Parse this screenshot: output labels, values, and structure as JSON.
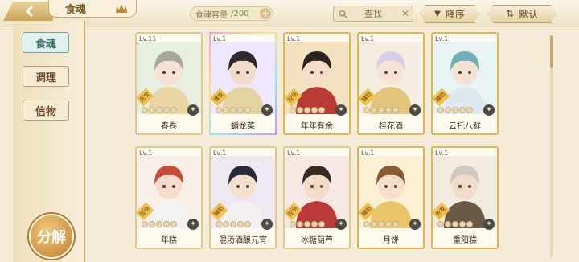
{
  "header": {
    "title": "食魂",
    "capacity_label": "食魂容量",
    "capacity_count": "/200",
    "search_placeholder": "查找",
    "sort_label": "降序",
    "default_label": "默认"
  },
  "sidebar": {
    "items": [
      {
        "label": "食魂",
        "active": true
      },
      {
        "label": "调理",
        "active": false
      },
      {
        "label": "信物",
        "active": false
      }
    ],
    "decompose_label": "分解"
  },
  "cards": [
    {
      "level": "Lv.11",
      "role": "先攻",
      "name": "春卷",
      "stars": 0,
      "style": "plain",
      "bg": "#e7efe0",
      "hair": "#a7a99a",
      "skin": "#f6e1d2",
      "outfit": "#e9d6a4"
    },
    {
      "level": "Lv.1",
      "role": "爆发",
      "name": "蟠龙菜",
      "stars": 0,
      "style": "rainbow",
      "bg": "#efe6ff",
      "hair": "#2e2a2a",
      "skin": "#f2dcc9",
      "outfit": "#e2d3a0"
    },
    {
      "level": "Lv.1",
      "role": "控场",
      "name": "年年有余",
      "stars": 0,
      "style": "gold",
      "bg": "#f3e2c0",
      "hair": "#2a2322",
      "skin": "#f6ddc7",
      "outfit": "#b83b36"
    },
    {
      "level": "Lv.1",
      "role": "辅助",
      "name": "桂花酒",
      "stars": 0,
      "style": "gold",
      "bg": "#f3eee0",
      "hair": "#d8cfe6",
      "skin": "#f6e3d3",
      "outfit": "#e2c47a"
    },
    {
      "level": "Lv.1",
      "role": "辅助",
      "name": "云托八鲜",
      "stars": 0,
      "style": "gold",
      "bg": "#e8f3f3",
      "hair": "#6fb0b6",
      "skin": "#f4e2d4",
      "outfit": "#dfe8ee"
    },
    {
      "level": "Lv.1",
      "role": "控场",
      "name": "年糕",
      "stars": 0,
      "style": "plain",
      "bg": "#f7efe8",
      "hair": "#c24c39",
      "skin": "#f5dccb",
      "outfit": "#f2f2f2"
    },
    {
      "level": "Lv.1",
      "role": "辅助",
      "name": "混汤酒酿元宵",
      "stars": 0,
      "style": "plain",
      "bg": "#eee8f3",
      "hair": "#2a2a3a",
      "skin": "#f6e0d0",
      "outfit": "#f4f0f2"
    },
    {
      "level": "Lv.1",
      "role": "控场",
      "name": "冰糖葫芦",
      "stars": 0,
      "style": "plain",
      "bg": "#f6e8e4",
      "hair": "#3a2a24",
      "skin": "#f5dcc9",
      "outfit": "#b93a38"
    },
    {
      "level": "Lv.1",
      "role": "辅助",
      "name": "月饼",
      "stars": 0,
      "style": "gold",
      "bg": "#fbefd4",
      "hair": "#8a5a34",
      "skin": "#f6dfca",
      "outfit": "#e9c56a"
    },
    {
      "level": "Lv.1",
      "role": "先攻",
      "name": "重阳糕",
      "stars": 0,
      "style": "gold",
      "bg": "#f1ebe0",
      "hair": "#cfc8bc",
      "skin": "#f1dccb",
      "outfit": "#6a5a4a"
    }
  ]
}
